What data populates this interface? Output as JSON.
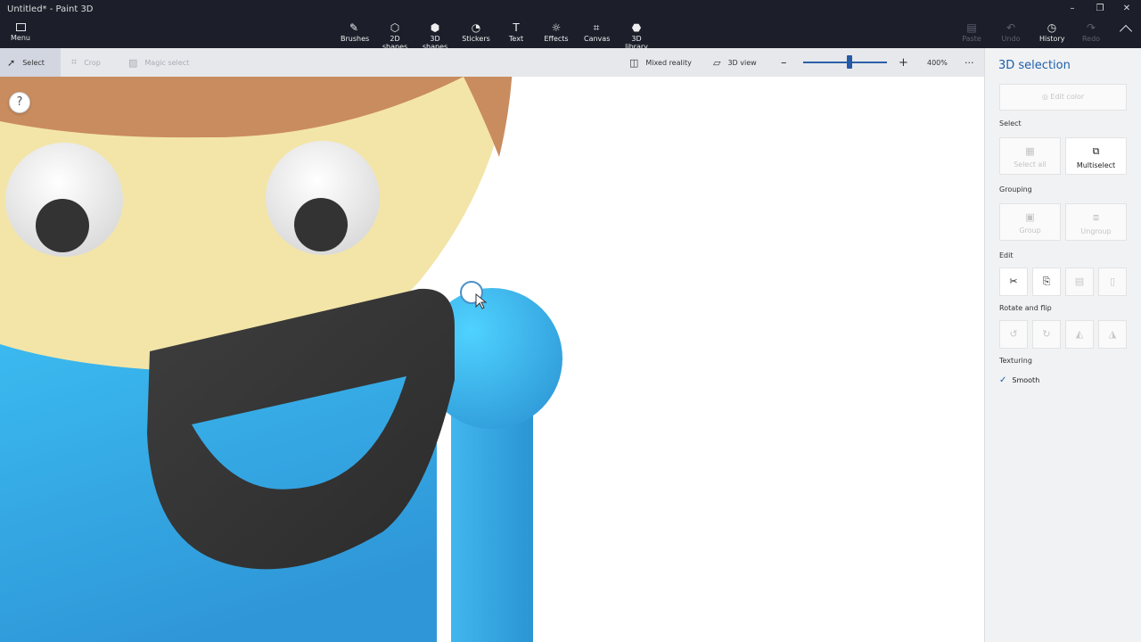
{
  "window": {
    "title": "Untitled* - Paint 3D"
  },
  "menu": {
    "label": "Menu"
  },
  "tools": [
    {
      "label": "Brushes",
      "icon": "brush-icon"
    },
    {
      "label": "2D shapes",
      "icon": "2d-shapes-icon"
    },
    {
      "label": "3D shapes",
      "icon": "3d-shapes-icon"
    },
    {
      "label": "Stickers",
      "icon": "stickers-icon"
    },
    {
      "label": "Text",
      "icon": "text-icon"
    },
    {
      "label": "Effects",
      "icon": "effects-icon"
    },
    {
      "label": "Canvas",
      "icon": "canvas-icon"
    },
    {
      "label": "3D library",
      "icon": "3d-library-icon"
    }
  ],
  "right_tools": {
    "paste": "Paste",
    "undo": "Undo",
    "history": "History",
    "redo": "Redo"
  },
  "commandbar": {
    "select": "Select",
    "crop": "Crop",
    "magic_select": "Magic select",
    "mixed_reality": "Mixed reality",
    "view_3d": "3D view",
    "zoom_value": "400%",
    "zoom_level": 0.55
  },
  "canvas": {
    "help_label": "?"
  },
  "panel": {
    "title": "3D selection",
    "edit_color": "Edit color",
    "select_section": "Select",
    "select_all": "Select all",
    "multiselect": "Multiselect",
    "grouping_section": "Grouping",
    "group": "Group",
    "ungroup": "Ungroup",
    "edit_section": "Edit",
    "rotate_section": "Rotate and flip",
    "texturing_section": "Texturing",
    "smooth": "Smooth"
  },
  "colors": {
    "accent": "#1c5fa8",
    "body_blue": "#3aaee8",
    "face": "#f2e3a6",
    "hair": "#c88a5c",
    "beard": "#3a3a3a"
  }
}
